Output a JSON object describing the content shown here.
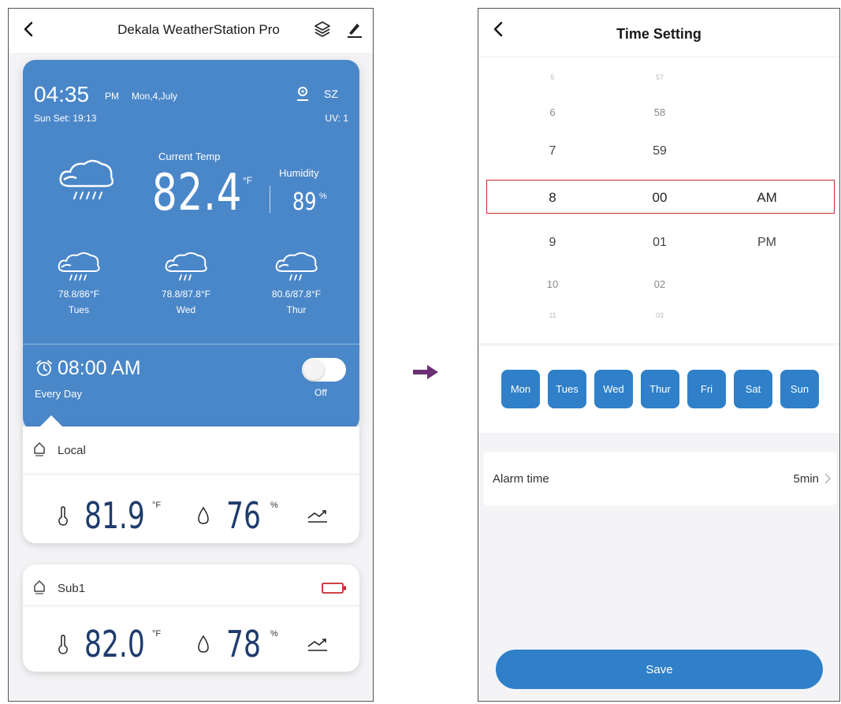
{
  "left_screen": {
    "header": {
      "title": "Dekala WeatherStation Pro",
      "back_icon": "chevron-left-icon",
      "layers_icon": "layers-icon",
      "edit_icon": "pencil-icon"
    },
    "weather": {
      "time": "04:35",
      "ampm": "PM",
      "date": "Mon,4,July",
      "location": "SZ",
      "sunset": "Sun Set: 19:13",
      "uv": "UV:  1",
      "current_temp_label": "Current Temp",
      "current_temp": "82.4",
      "current_temp_unit": "°F",
      "humidity_label": "Humidity",
      "humidity": "89",
      "humidity_unit": "%",
      "forecast": [
        {
          "range": "78.8/86°F",
          "day": "Tues"
        },
        {
          "range": "78.8/87.8°F",
          "day": "Wed"
        },
        {
          "range": "80.6/87.8°F",
          "day": "Thur"
        }
      ],
      "alarm_time": "08:00 AM",
      "alarm_repeat": "Every Day",
      "alarm_state": "Off"
    },
    "sensors": [
      {
        "name": "Local",
        "temp": "81.9",
        "temp_unit": "°F",
        "humidity": "76",
        "humidity_unit": "%"
      },
      {
        "name": "Sub1",
        "temp": "82.0",
        "temp_unit": "°F",
        "humidity": "78",
        "humidity_unit": "%"
      }
    ]
  },
  "right_screen": {
    "header": {
      "title": "Time Setting",
      "back_icon": "chevron-left-icon"
    },
    "picker": {
      "hours": [
        "5",
        "6",
        "7",
        "8",
        "9",
        "10",
        "11"
      ],
      "minutes": [
        "57",
        "58",
        "59",
        "00",
        "01",
        "02",
        "03"
      ],
      "ampm": [
        "AM",
        "PM"
      ],
      "selected": {
        "hour": "8",
        "minute": "00",
        "ampm": "AM"
      }
    },
    "days": [
      "Mon",
      "Tues",
      "Wed",
      "Thur",
      "Fri",
      "Sat",
      "Sun"
    ],
    "alarm_time_label": "Alarm time",
    "alarm_time_value": "5min",
    "save_label": "Save",
    "accent_color": "#2f80c9",
    "selection_color": "#c8282c"
  }
}
